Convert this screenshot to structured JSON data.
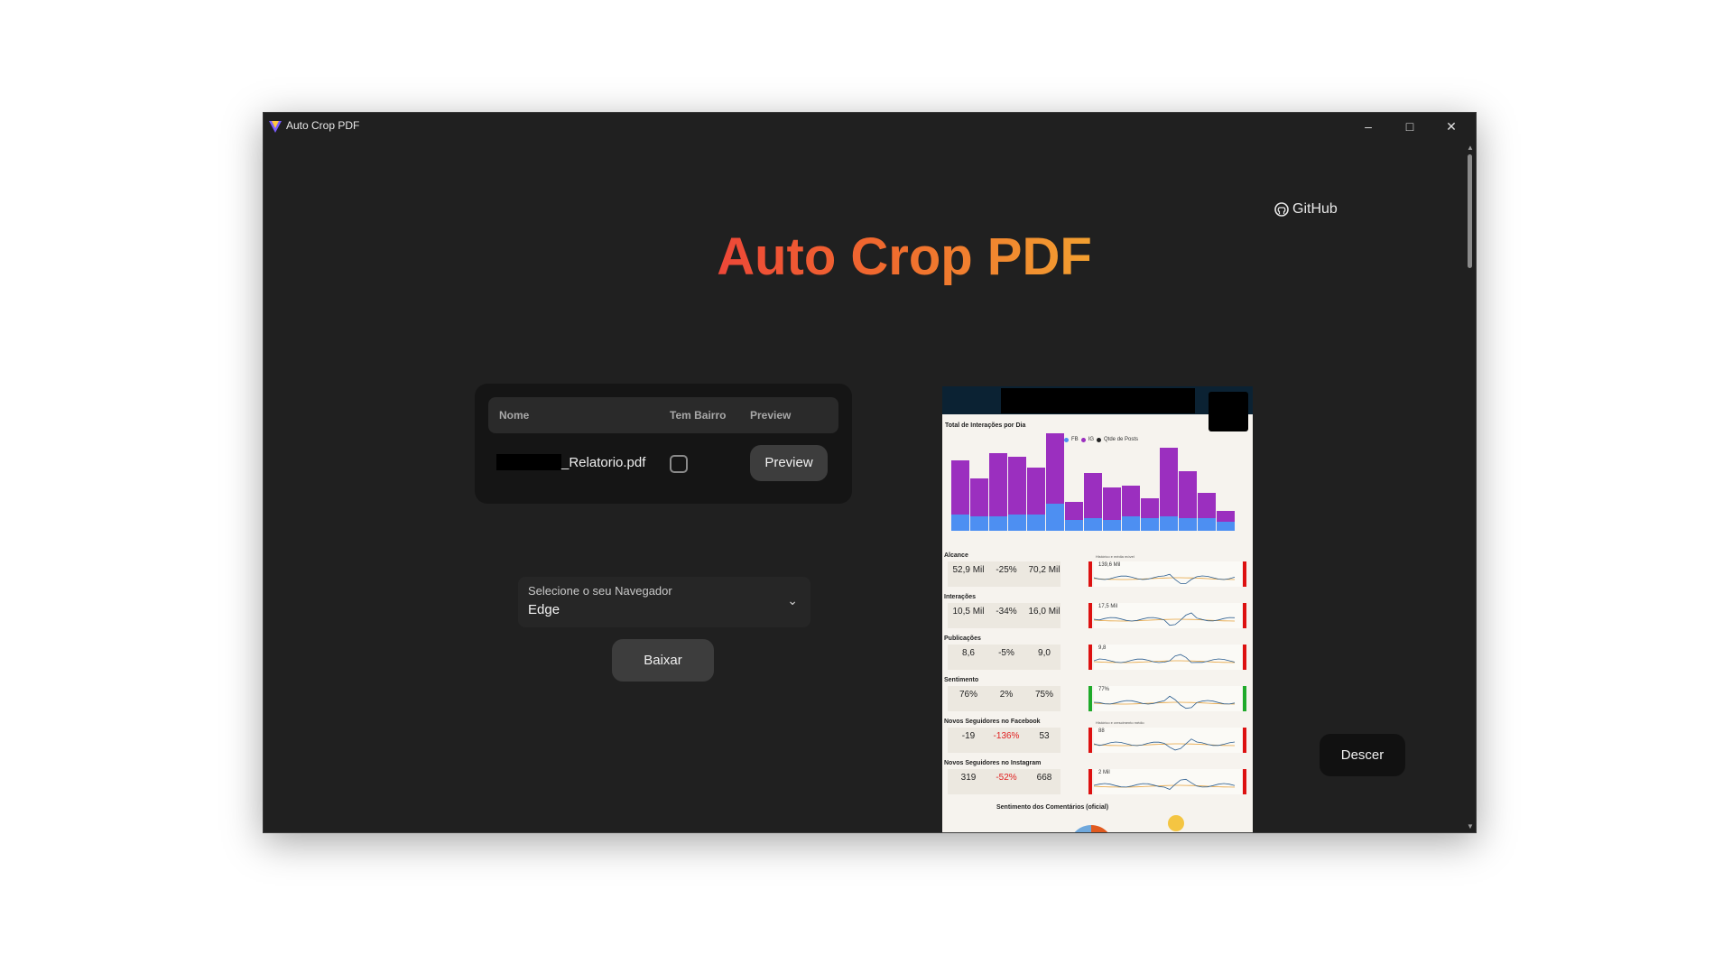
{
  "window": {
    "title": "Auto Crop PDF"
  },
  "header": {
    "github_label": "GitHub",
    "hero_title": "Auto Crop PDF"
  },
  "files_table": {
    "columns": [
      "Nome",
      "Tem Bairro",
      "Preview"
    ],
    "rows": [
      {
        "name": "_Relatorio.pdf",
        "tem_bairro": false,
        "action": "Preview"
      }
    ]
  },
  "browser_select": {
    "label": "Selecione o seu Navegador",
    "value": "Edge"
  },
  "buttons": {
    "download": "Baixar",
    "scroll_down": "Descer"
  },
  "pdf_preview": {
    "chart_title": "Total de Interações por Dia",
    "legend": [
      "FB",
      "IG",
      "Qtde de Posts"
    ],
    "sections": [
      {
        "title": "Alcance",
        "values": [
          "52,9 Mil",
          "-25%",
          "70,2 Mil"
        ],
        "spark_label": "139,6 Mil",
        "spark_caption": "Histórico e média móvel"
      },
      {
        "title": "Interações",
        "values": [
          "10,5 Mil",
          "-34%",
          "16,0 Mil"
        ],
        "spark_label": "17,5 Mil"
      },
      {
        "title": "Publicações",
        "values": [
          "8,6",
          "-5%",
          "9,0"
        ],
        "spark_label": "9,8"
      },
      {
        "title": "Sentimento",
        "values": [
          "76%",
          "2%",
          "75%"
        ],
        "spark_label": "77%"
      },
      {
        "title": "Novos Seguidores no Facebook",
        "values": [
          "-19",
          "-136%",
          "53"
        ],
        "spark_label": "88",
        "spark_caption": "Histórico e crescimento médio"
      },
      {
        "title": "Novos Seguidores no Instagram",
        "values": [
          "319",
          "-52%",
          "668"
        ],
        "spark_label": "2 Mil"
      }
    ],
    "footer_title": "Sentimento dos Comentários (oficial)"
  }
}
